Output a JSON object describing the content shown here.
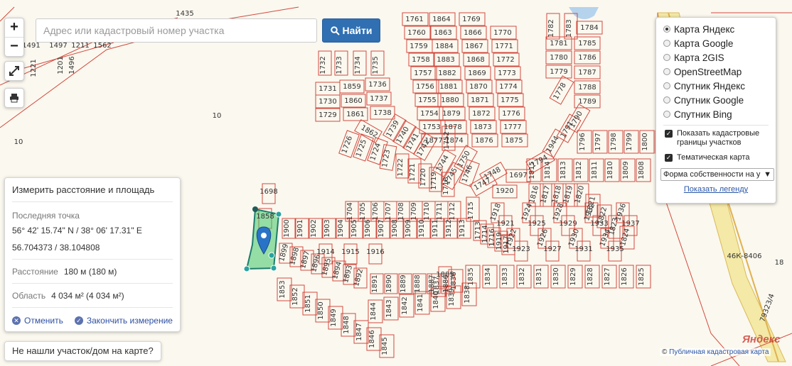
{
  "search": {
    "placeholder": "Адрес или кадастровый номер участка",
    "button_label": "Найти"
  },
  "zoom": {
    "in": "+",
    "out": "−"
  },
  "layers": {
    "options": [
      {
        "label": "Карта Яндекс",
        "checked": true
      },
      {
        "label": "Карта Google",
        "checked": false
      },
      {
        "label": "Карта 2GIS",
        "checked": false
      },
      {
        "label": "OpenStreetMap",
        "checked": false
      },
      {
        "label": "Спутник Яндекс",
        "checked": false
      },
      {
        "label": "Спутник Google",
        "checked": false
      },
      {
        "label": "Спутник Bing",
        "checked": false
      }
    ],
    "cadastral_borders": "Показать кадастровые границы участков",
    "thematic_map": "Тематическая карта",
    "select_value": "Форма собственности на у",
    "legend_link": "Показать легенду"
  },
  "measure": {
    "title": "Измерить расстояние и площадь",
    "last_point_label": "Последняя точка",
    "coords_dms": "56° 42' 15.74\" N / 38° 06' 17.31\" E",
    "coords_dec": "56.704373 / 38.104808",
    "distance_label": "Расстояние",
    "distance_value": "180 м (180 м)",
    "area_label": "Область",
    "area_value": "4 034 м² (4 034 м²)",
    "cancel": "Отменить",
    "finish": "Закончить измерение"
  },
  "not_found": "Не нашли участок/дом на карте?",
  "attribution": {
    "copyright": "©",
    "link": "Публичная кадастровая карта"
  },
  "yandex_logo": "Яндекс",
  "map": {
    "labels_misc": [
      "10",
      "10",
      "46К-8406",
      "18",
      "79323/4",
      "1491",
      "1497",
      "1211",
      "1562",
      "1221",
      "1201",
      "1496",
      "1435"
    ],
    "column_a": [
      "1732",
      "1733",
      "1734",
      "1735",
      "1731",
      "1859",
      "1736",
      "1730",
      "1860",
      "1737",
      "1729",
      "1861",
      "1738",
      "1862",
      "1739",
      "1740",
      "1741",
      "1742",
      "1752"
    ],
    "column_b": [
      "1761",
      "1864",
      "1769",
      "1760",
      "1863",
      "1866",
      "1770",
      "1759",
      "1884",
      "1867",
      "1771",
      "1758",
      "1883",
      "1868",
      "1772",
      "1757",
      "1882",
      "1869",
      "1773",
      "1756",
      "1881",
      "1870",
      "1774",
      "1755",
      "1880",
      "1871",
      "1775",
      "1754",
      "1879",
      "1872",
      "1776",
      "1753",
      "1878",
      "1873",
      "1777",
      "1877",
      "1874",
      "1876",
      "1875"
    ],
    "column_c": [
      "1782",
      "1783",
      "1784",
      "1781",
      "1785",
      "1780",
      "1786",
      "1779",
      "1787",
      "1778",
      "1788",
      "1789",
      "1790",
      "1791",
      "1944",
      "1794"
    ],
    "diag_left": [
      "1726",
      "1725",
      "1724",
      "1723",
      "1722",
      "1721",
      "1720",
      "1719",
      "1718",
      "1745",
      "1744",
      "1750",
      "1746",
      "1747",
      "1748",
      "1697",
      "1920",
      "1715"
    ],
    "right_cluster": [
      "1796",
      "1797",
      "1798",
      "1799",
      "1800",
      "1807",
      "1808",
      "1809",
      "1810",
      "1811",
      "1812",
      "1813",
      "1814",
      "1815",
      "1816",
      "1817",
      "1818",
      "1819",
      "1820",
      "1821",
      "1822",
      "1823",
      "1824",
      "1825",
      "1826",
      "1827",
      "1828",
      "1829",
      "1830",
      "1831",
      "1832",
      "1833",
      "1834",
      "1835",
      "1836",
      "1837",
      "1838",
      "1839",
      "1840",
      "1841",
      "1842",
      "1843",
      "1844",
      "1845",
      "1846",
      "1847",
      "1848",
      "1849",
      "1850",
      "1851",
      "1852",
      "1853"
    ],
    "center": [
      "1698",
      "1858",
      "1900",
      "1901",
      "1902",
      "1903",
      "1904",
      "1905",
      "1906",
      "1907",
      "1908",
      "1909",
      "1910",
      "1911",
      "1912",
      "1913",
      "1914",
      "1915",
      "1916",
      "1899",
      "1898",
      "1897",
      "1896",
      "1895",
      "1894",
      "1893",
      "1892",
      "1891",
      "1890",
      "1889",
      "1888",
      "1887",
      "1886",
      "1885",
      "1704",
      "1705",
      "1706",
      "1707",
      "1708",
      "1709",
      "1710",
      "1711",
      "1712",
      "1713",
      "1714",
      "1716",
      "1919",
      "1917",
      "1918",
      "1921",
      "1922",
      "1923",
      "1924",
      "1925",
      "1926",
      "1927",
      "1928",
      "1929",
      "1930",
      "1931",
      "1932",
      "1933",
      "1934",
      "1935",
      "1936",
      "1937"
    ]
  }
}
